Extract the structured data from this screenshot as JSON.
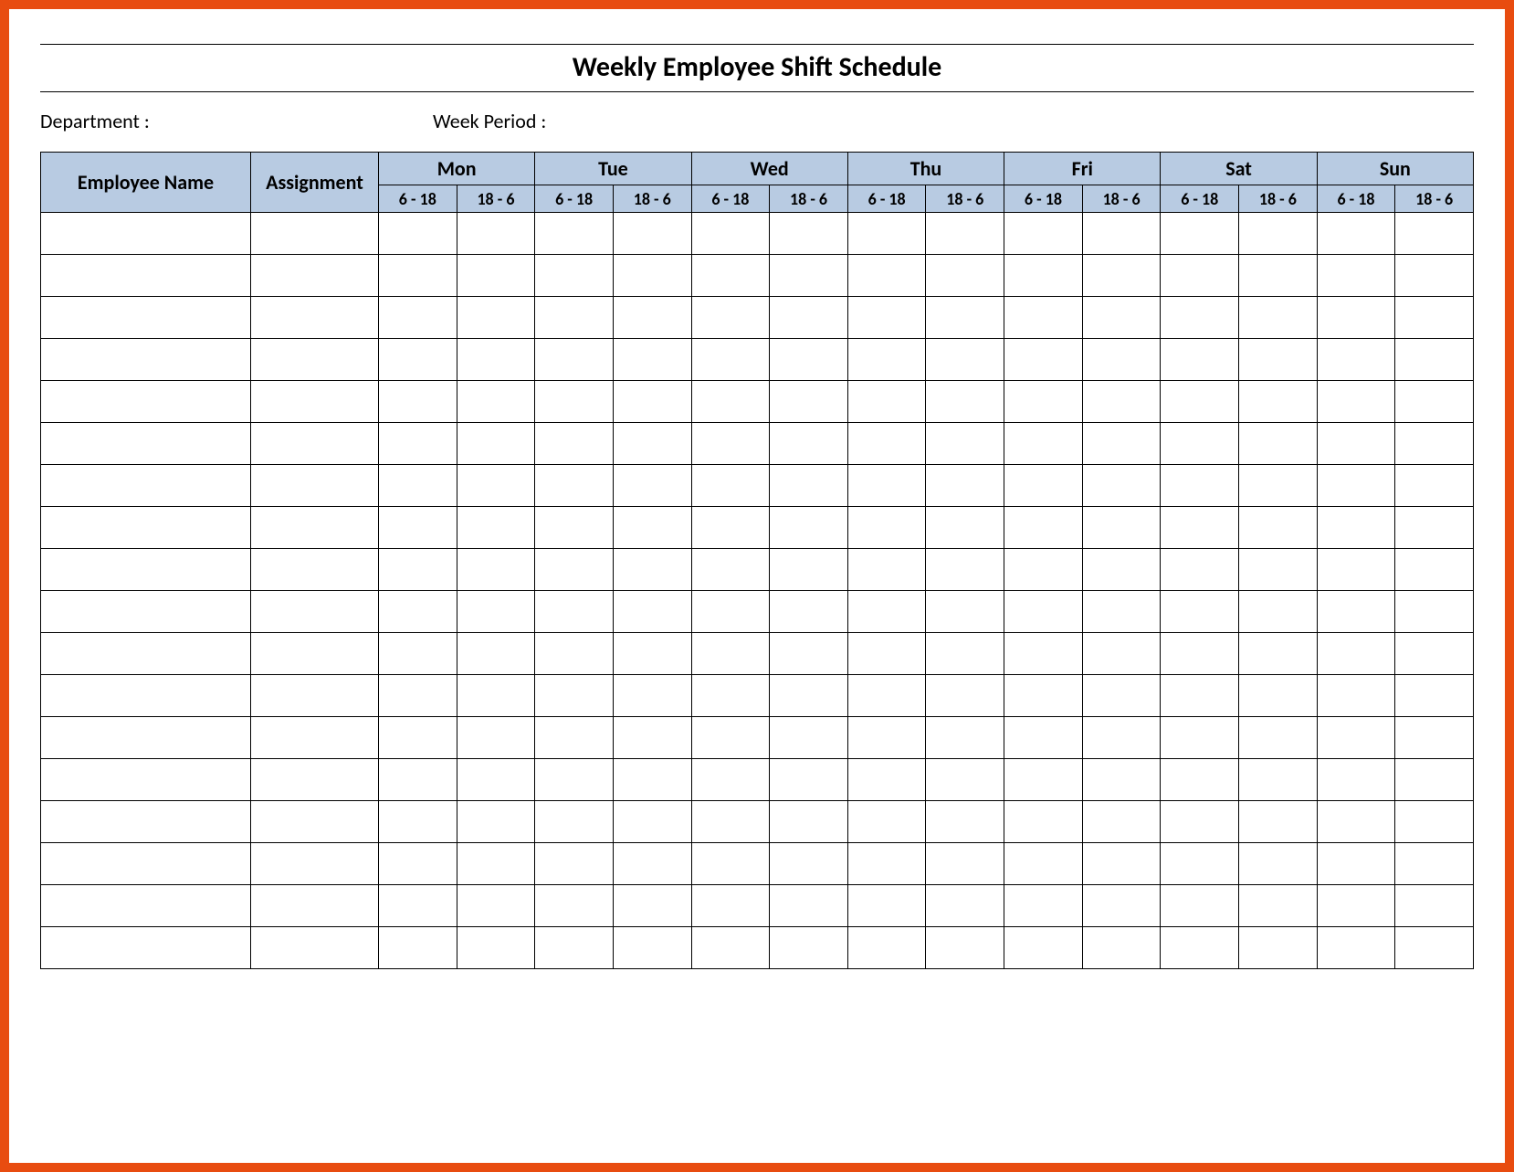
{
  "title": "Weekly Employee Shift Schedule",
  "meta": {
    "department_label": "Department :",
    "week_period_label": "Week  Period :"
  },
  "columns": {
    "employee_name": "Employee Name",
    "assignment": "Assignment"
  },
  "days": [
    "Mon",
    "Tue",
    "Wed",
    "Thu",
    "Fri",
    "Sat",
    "Sun"
  ],
  "shifts": [
    "6 - 18",
    "18 - 6"
  ],
  "row_count": 18,
  "colors": {
    "frame": "#e84c10",
    "header_bg": "#b8cbe2"
  },
  "chart_data": {
    "type": "table",
    "title": "Weekly Employee Shift Schedule",
    "columns": [
      "Employee Name",
      "Assignment",
      "Mon 6 - 18",
      "Mon 18 - 6",
      "Tue 6 - 18",
      "Tue 18 - 6",
      "Wed 6 - 18",
      "Wed 18 - 6",
      "Thu 6 - 18",
      "Thu 18 - 6",
      "Fri 6 - 18",
      "Fri 18 - 6",
      "Sat 6 - 18",
      "Sat 18 - 6",
      "Sun 6 - 18",
      "Sun 18 - 6"
    ],
    "rows": []
  }
}
